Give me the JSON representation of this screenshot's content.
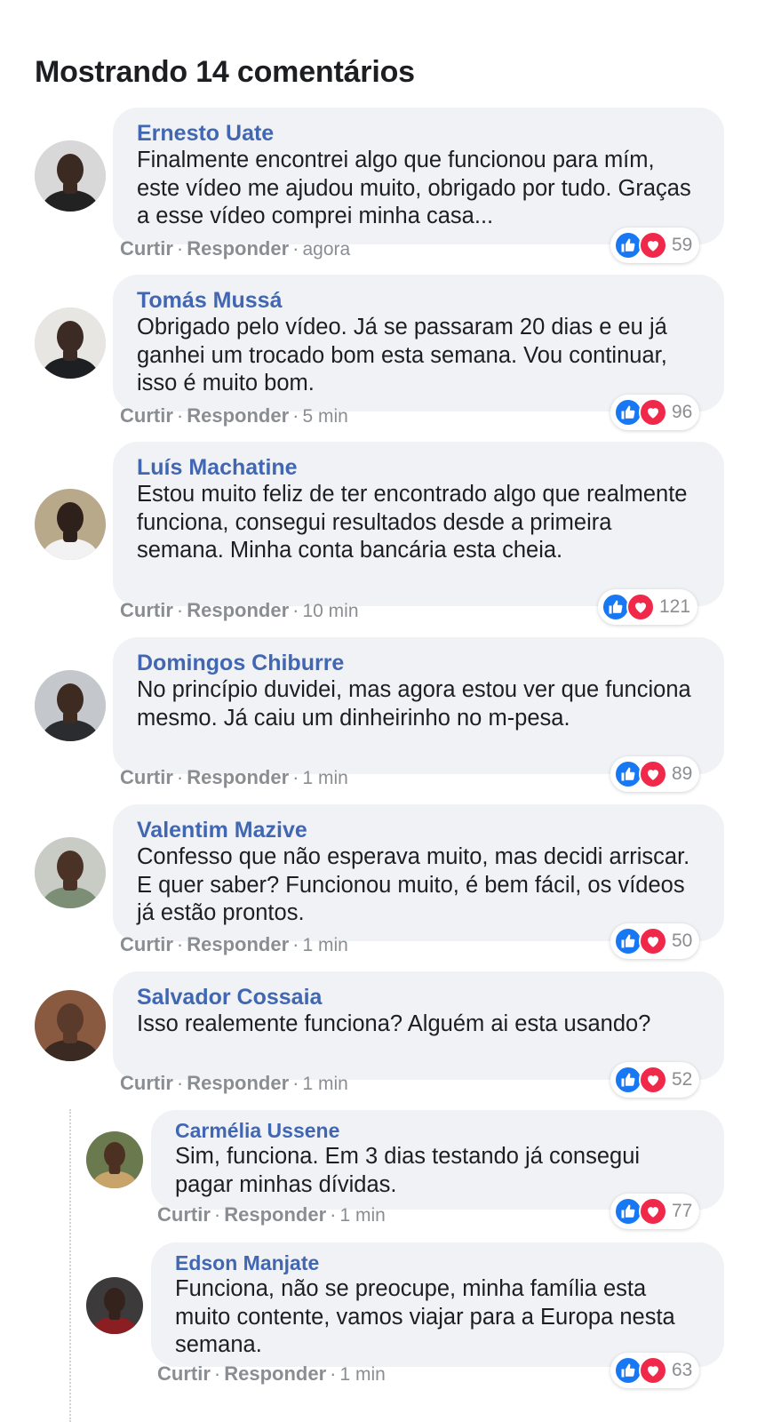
{
  "heading": "Mostrando 14 comentários",
  "actions": {
    "like": "Curtir",
    "reply": "Responder",
    "sep": "·"
  },
  "colors": {
    "author": "#4267b2",
    "bubble": "#f0f2f5",
    "like": "#1877f2",
    "love": "#f02849"
  },
  "comments": [
    {
      "author": "Ernesto Uate",
      "text": "Finalmente encontrei algo que funcionou para mím, este vídeo me ajudou muito, obrigado por tudo. Graças a esse vídeo comprei minha casa...",
      "time": "agora",
      "count": "59",
      "skin": "#3a2a22",
      "bg": "#d8d8d8",
      "shirt": "#222222"
    },
    {
      "author": "Tomás Mussá",
      "text": "Obrigado pelo vídeo. Já se passaram 20 dias e eu já ganhei um trocado bom esta semana. Vou continuar, isso é muito bom.",
      "time": "5 min",
      "count": "96",
      "skin": "#3b2b24",
      "bg": "#e8e6e2",
      "shirt": "#1d1f22"
    },
    {
      "author": "Luís Machatine",
      "text": "Estou muito feliz de ter encontrado algo que realmente funciona, consegui resultados desde a primeira semana. Minha conta bancária esta cheia.",
      "time": "10 min",
      "count": "121",
      "skin": "#2e211b",
      "bg": "#b9a98b",
      "shirt": "#f2f2f2"
    },
    {
      "author": "Domingos Chiburre",
      "text": "No princípio duvidei, mas agora estou ver que funciona mesmo. Já caiu um dinheirinho no m-pesa.",
      "time": "1 min",
      "count": "89",
      "skin": "#3d2a20",
      "bg": "#c4c8cc",
      "shirt": "#2a2c30"
    },
    {
      "author": "Valentim Mazive",
      "text": "Confesso que não esperava muito, mas decidi arriscar. E quer saber? Funcionou muito, é bem fácil, os vídeos já estão prontos.",
      "time": "1 min",
      "count": "50",
      "skin": "#4a3226",
      "bg": "#c9ccc5",
      "shirt": "#7c8f76"
    },
    {
      "author": "Salvador Cossaia",
      "text": "Isso realemente funciona? Alguém ai esta usando?",
      "time": "1 min",
      "count": "52",
      "skin": "#5a3a2a",
      "bg": "#8a5a40",
      "shirt": "#3a2a22"
    },
    {
      "author": "Carmélia Ussene",
      "text": "Sim, funciona. Em 3 dias testando já consegui pagar minhas dívidas.",
      "time": "1 min",
      "count": "77",
      "skin": "#4c3122",
      "bg": "#6b7a4e",
      "shirt": "#c9a46a"
    },
    {
      "author": "Edson Manjate",
      "text": "Funciona, não se preocupe, minha família esta muito contente, vamos viajar para a Europa nesta semana.",
      "time": "1 min",
      "count": "63",
      "skin": "#33231c",
      "bg": "#3c3a3a",
      "shirt": "#8a1e22"
    }
  ]
}
